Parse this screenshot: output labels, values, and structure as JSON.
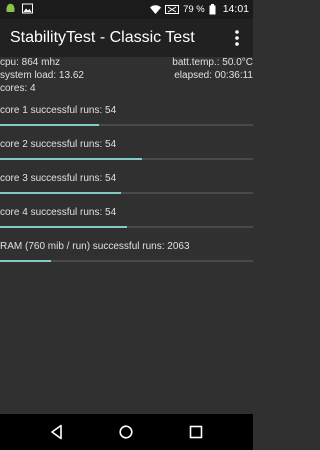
{
  "status_bar": {
    "battery_percent": "79 %",
    "time": "14:01",
    "icons": [
      "android-icon",
      "image-icon",
      "wifi-icon",
      "no-sim-icon",
      "battery-icon"
    ]
  },
  "toolbar": {
    "title": "StabilityTest - Classic Test",
    "overflow_icon": "more-vert-icon"
  },
  "info": {
    "cpu": "cpu: 864 mhz",
    "batt_temp": "batt.temp.: 50.0°C",
    "system_load": "system load: 13.62",
    "elapsed": "elapsed: 00:36:11",
    "cores": "cores: 4"
  },
  "cores": [
    {
      "label": "core 1 successful runs: 54",
      "progress": 0.39
    },
    {
      "label": "core 2 successful runs: 54",
      "progress": 0.56
    },
    {
      "label": "core 3 successful runs: 54",
      "progress": 0.48
    },
    {
      "label": "core 4 successful runs: 54",
      "progress": 0.5
    }
  ],
  "ram": {
    "label": "RAM (760 mib / run) successful runs: 2063",
    "progress": 0.2
  },
  "colors": {
    "progress_fill": "#80cbc4",
    "progress_track": "#4a4a4a",
    "background": "#303030",
    "toolbar": "#212121"
  },
  "nav_bar": {
    "icons": [
      "back-icon",
      "home-icon",
      "recents-icon"
    ]
  }
}
